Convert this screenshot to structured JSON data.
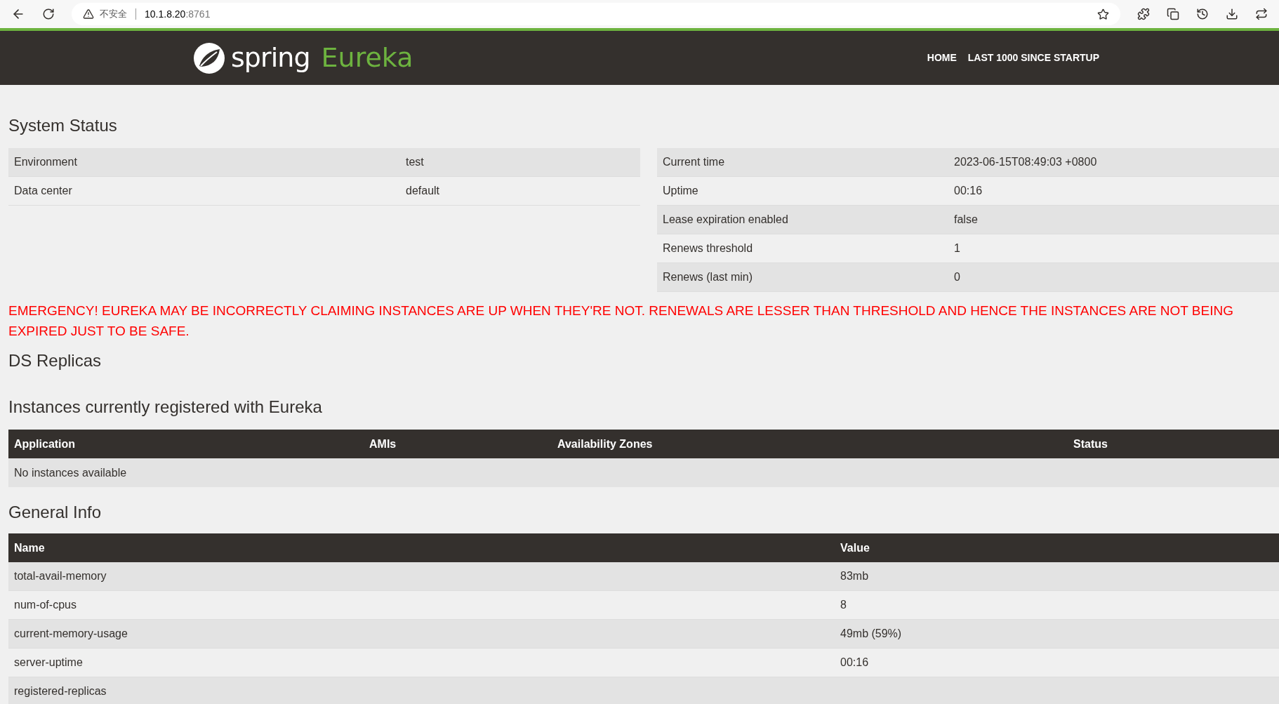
{
  "browser": {
    "security_label": "不安全",
    "url_host": "10.1.8.20",
    "url_port": ":8761"
  },
  "header": {
    "logo_word": "spring",
    "logo_product": "Eureka",
    "nav": [
      {
        "label": "HOME"
      },
      {
        "label": "LAST 1000 SINCE STARTUP"
      }
    ]
  },
  "system_status": {
    "title": "System Status",
    "left_rows": [
      {
        "name": "Environment",
        "value": "test"
      },
      {
        "name": "Data center",
        "value": "default"
      }
    ],
    "right_rows": [
      {
        "name": "Current time",
        "value": "2023-06-15T08:49:03 +0800"
      },
      {
        "name": "Uptime",
        "value": "00:16"
      },
      {
        "name": "Lease expiration enabled",
        "value": "false"
      },
      {
        "name": "Renews threshold",
        "value": "1"
      },
      {
        "name": "Renews (last min)",
        "value": "0"
      }
    ]
  },
  "emergency": "EMERGENCY! EUREKA MAY BE INCORRECTLY CLAIMING INSTANCES ARE UP WHEN THEY'RE NOT. RENEWALS ARE LESSER THAN THRESHOLD AND HENCE THE INSTANCES ARE NOT BEING EXPIRED JUST TO BE SAFE.",
  "ds_replicas": {
    "title": "DS Replicas"
  },
  "instances": {
    "title": "Instances currently registered with Eureka",
    "columns": [
      "Application",
      "AMIs",
      "Availability Zones",
      "Status"
    ],
    "empty_text": "No instances available"
  },
  "general_info": {
    "title": "General Info",
    "columns": [
      "Name",
      "Value"
    ],
    "rows": [
      {
        "name": "total-avail-memory",
        "value": "83mb"
      },
      {
        "name": "num-of-cpus",
        "value": "8"
      },
      {
        "name": "current-memory-usage",
        "value": "49mb (59%)"
      },
      {
        "name": "server-uptime",
        "value": "00:16"
      },
      {
        "name": "registered-replicas"
      }
    ]
  }
}
